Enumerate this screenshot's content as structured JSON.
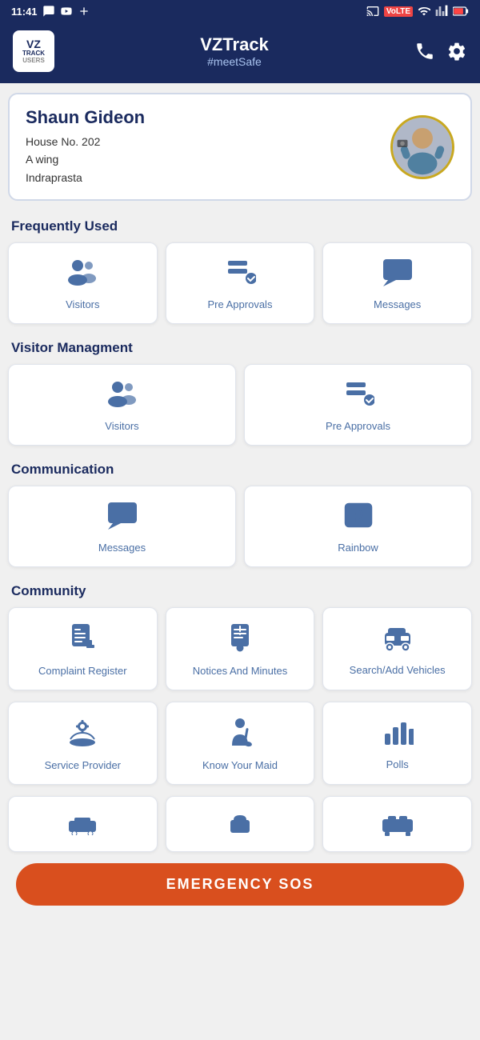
{
  "statusBar": {
    "time": "11:41",
    "icons": [
      "message-icon",
      "youtube-icon",
      "plus-icon",
      "cast-icon",
      "volte-icon",
      "wifi-icon",
      "signal-icon",
      "battery-icon"
    ]
  },
  "header": {
    "logoLine1": "VZ",
    "logoLine2": "TRACK",
    "logoLine3": "USERS",
    "title": "VZTrack",
    "subtitle": "#meetSafe",
    "phoneIconLabel": "phone-icon",
    "settingsIconLabel": "settings-icon"
  },
  "userCard": {
    "name": "Shaun Gideon",
    "line1": "House No. 202",
    "line2": "A wing",
    "line3": "Indraprasta"
  },
  "sections": {
    "frequentlyUsed": {
      "label": "Frequently Used",
      "items": [
        {
          "id": "visitors-freq",
          "label": "Visitors",
          "icon": "visitors-icon"
        },
        {
          "id": "preapprovals-freq",
          "label": "Pre Approvals",
          "icon": "preapprovals-icon"
        },
        {
          "id": "messages-freq",
          "label": "Messages",
          "icon": "messages-icon"
        }
      ]
    },
    "visitorManagement": {
      "label": "Visitor Managment",
      "items": [
        {
          "id": "visitors-vm",
          "label": "Visitors",
          "icon": "visitors-icon"
        },
        {
          "id": "preapprovals-vm",
          "label": "Pre Approvals",
          "icon": "preapprovals-icon"
        }
      ]
    },
    "communication": {
      "label": "Communication",
      "items": [
        {
          "id": "messages-comm",
          "label": "Messages",
          "icon": "messages-icon"
        },
        {
          "id": "rainbow-comm",
          "label": "Rainbow",
          "icon": "rainbow-icon"
        }
      ]
    },
    "community": {
      "label": "Community",
      "row1": [
        {
          "id": "complaint-register",
          "label": "Complaint Register",
          "icon": "complaint-icon"
        },
        {
          "id": "notices-minutes",
          "label": "Notices And Minutes",
          "icon": "notices-icon"
        },
        {
          "id": "search-vehicles",
          "label": "Search/Add Vehicles",
          "icon": "vehicles-icon"
        }
      ],
      "row2": [
        {
          "id": "service-provider",
          "label": "Service Provider",
          "icon": "service-icon"
        },
        {
          "id": "know-your-maid",
          "label": "Know Your Maid",
          "icon": "maid-icon"
        },
        {
          "id": "polls",
          "label": "Polls",
          "icon": "polls-icon"
        }
      ]
    }
  },
  "emergencyButton": {
    "label": "EMERGENCY SOS"
  }
}
